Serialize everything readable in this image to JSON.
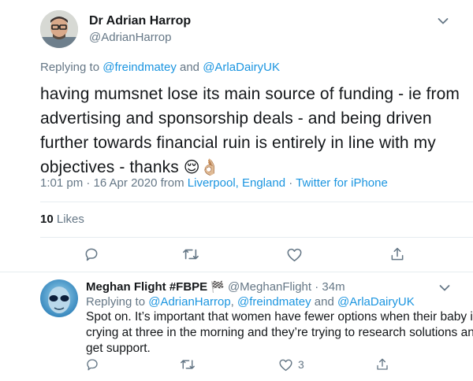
{
  "main_tweet": {
    "author_name": "Dr Adrian Harrop",
    "author_handle": "@AdrianHarrop",
    "replying_prefix": "Replying to ",
    "replying_user1": "@freindmatey",
    "replying_and": " and ",
    "replying_user2": "@ArlaDairyUK",
    "text_line1": "having mumsnet lose its main source of funding - ie from",
    "text_line2": "advertising and sponsorship deals - and being driven",
    "text_line3": "further towards financial ruin is entirely in line with my",
    "text_line4": "objectives - thanks",
    "emoji1": "😌",
    "emoji2": "👌🏼",
    "timestamp": "1:01 pm · 16 Apr 2020 from ",
    "location": "Liverpool, England",
    "separator": " · ",
    "source": "Twitter for iPhone",
    "likes_count": "10",
    "likes_label": "Likes"
  },
  "reply_tweet": {
    "author_name": "Meghan Flight #FBPE",
    "flag_emoji": "🏁",
    "author_handle": "@MeghanFlight",
    "time": "· 34m",
    "replying_prefix": "Replying to ",
    "replying_user1": "@AdrianHarrop",
    "replying_sep": ", ",
    "replying_user2": "@freindmatey",
    "replying_and": " and ",
    "replying_user3": "@ArlaDairyUK",
    "text_line1": "Spot on. It’s important that women have fewer options when their baby is",
    "text_line2": "crying at three in the morning and they’re trying to research solutions and",
    "text_line3": "get support.",
    "like_count": "3"
  },
  "colors": {
    "link": "#1b95e0",
    "muted": "#657786",
    "text": "#14171a",
    "divider": "#e6ecf0"
  },
  "icons": [
    "chevron-down-icon",
    "reply-icon",
    "retweet-icon",
    "like-icon",
    "share-icon"
  ]
}
